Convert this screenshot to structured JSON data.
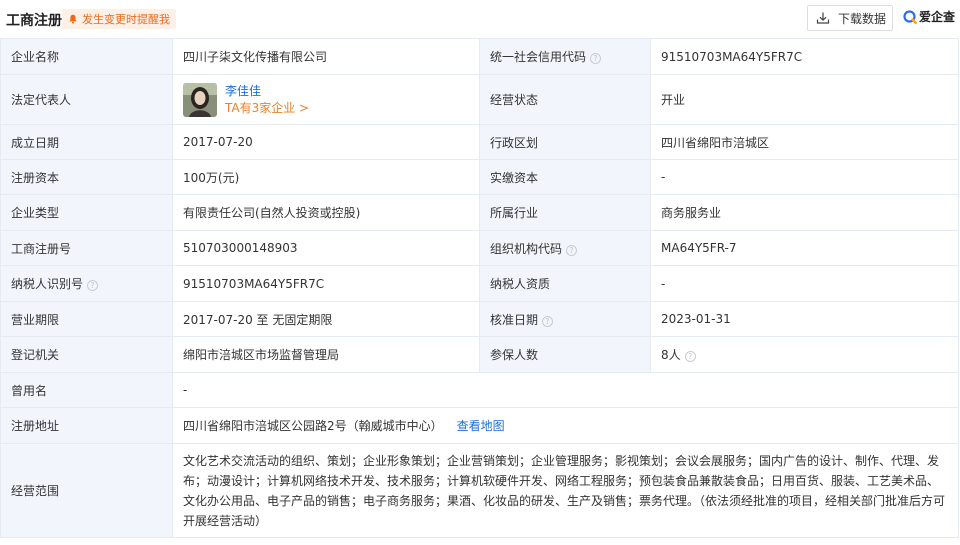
{
  "header": {
    "title": "工商注册",
    "remind_label": "发生变更时提醒我",
    "download_label": "下载数据",
    "logo_text": "爱企查"
  },
  "colors": {
    "label_bg": "#f2f6fc",
    "border": "#e6ebf2",
    "link": "#1a6fd8",
    "accent_orange": "#e8812a",
    "remind_bg": "#fdf0e6"
  },
  "rows": {
    "r1": {
      "l1": "企业名称",
      "v1": "四川子柒文化传播有限公司",
      "l2": "统一社会信用代码",
      "v2": "91510703MA64Y5FR7C"
    },
    "r2": {
      "l1": "法定代表人",
      "person_name": "李佳佳",
      "person_companies": "TA有3家企业 >",
      "l2": "经营状态",
      "v2": "开业"
    },
    "r3": {
      "l1": "成立日期",
      "v1": "2017-07-20",
      "l2": "行政区划",
      "v2": "四川省绵阳市涪城区"
    },
    "r4": {
      "l1": "注册资本",
      "v1": "100万(元)",
      "l2": "实缴资本",
      "v2": "-"
    },
    "r5": {
      "l1": "企业类型",
      "v1": "有限责任公司(自然人投资或控股)",
      "l2": "所属行业",
      "v2": "商务服务业"
    },
    "r6": {
      "l1": "工商注册号",
      "v1": "510703000148903",
      "l2": "组织机构代码",
      "v2": "MA64Y5FR-7"
    },
    "r7": {
      "l1": "纳税人识别号",
      "v1": "91510703MA64Y5FR7C",
      "l2": "纳税人资质",
      "v2": "-"
    },
    "r8": {
      "l1": "营业期限",
      "v1": "2017-07-20 至 无固定期限",
      "l2": "核准日期",
      "v2": "2023-01-31"
    },
    "r9": {
      "l1": "登记机关",
      "v1": "绵阳市涪城区市场监督管理局",
      "l2": "参保人数",
      "v2": "8人"
    },
    "r10": {
      "l1": "曾用名",
      "v1": "-"
    },
    "r11": {
      "l1": "注册地址",
      "v1": "四川省绵阳市涪城区公园路2号（翰威城市中心）",
      "map_link": "查看地图"
    },
    "r12": {
      "l1": "经营范围",
      "v1": "文化艺术交流活动的组织、策划；企业形象策划；企业营销策划；企业管理服务；影视策划；会议会展服务；国内广告的设计、制作、代理、发布；动漫设计；计算机网络技术开发、技术服务；计算机软硬件开发、网络工程服务；预包装食品兼散装食品；日用百货、服装、工艺美术品、文化办公用品、电子产品的销售；电子商务服务；果酒、化妆品的研发、生产及销售；票务代理。（依法须经批准的项目，经相关部门批准后方可开展经营活动）"
    }
  }
}
